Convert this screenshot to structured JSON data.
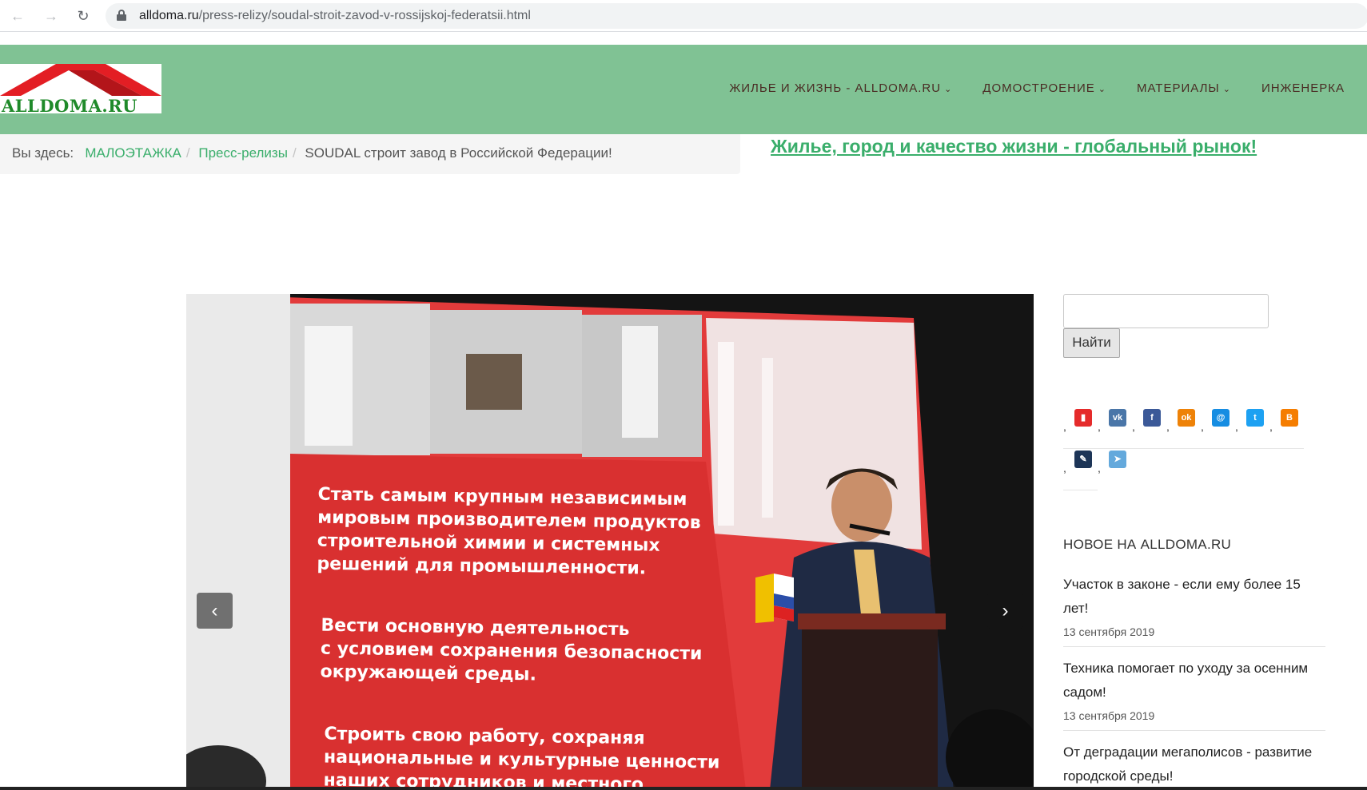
{
  "browser": {
    "url_host": "alldoma.ru",
    "url_path": "/press-relizy/soudal-stroit-zavod-v-rossijskoj-federatsii.html"
  },
  "header": {
    "logo_text": "ALLDOMA.RU",
    "bg_color": "#80c294",
    "nav": [
      {
        "label": "ЖИЛЬЕ И ЖИЗНЬ - ALLDOMA.RU",
        "has_dropdown": true
      },
      {
        "label": "ДОМОСТРОЕНИЕ",
        "has_dropdown": true
      },
      {
        "label": "МАТЕРИАЛЫ",
        "has_dropdown": true
      },
      {
        "label": "ИНЖЕНЕРКА",
        "has_dropdown": false
      }
    ]
  },
  "breadcrumb": {
    "prefix": "Вы здесь:",
    "items": [
      "МАЛОЭТАЖКА",
      "Пресс-релизы",
      "SOUDAL строит завод в Российской Федерации!"
    ]
  },
  "promo_link": "Жилье, город и качество жизни - глобальный рынок!",
  "slider": {
    "text_blocks": [
      "Стать самым крупным независимым\nмировым производителем продуктов\nстроительной химии и системных\nрешений для промышленности.",
      "Вести основную деятельность\nс условием сохранения безопасности\nокружающей среды.",
      "Строить свою работу, сохраняя\nнациональные и культурные ценности\nнаших сотрудников и местного"
    ],
    "prev_icon": "chevron-left-icon",
    "next_icon": "chevron-right-icon"
  },
  "sidebar": {
    "search_button": "Найти",
    "share_icons": [
      {
        "name": "bookmark-icon",
        "color": "#e52b2b",
        "glyph": "▮"
      },
      {
        "name": "vk-icon",
        "color": "#4a76a8",
        "glyph": "vk"
      },
      {
        "name": "facebook-icon",
        "color": "#3b5998",
        "glyph": "f"
      },
      {
        "name": "odnoklassniki-icon",
        "color": "#ee8208",
        "glyph": "ok"
      },
      {
        "name": "mailru-icon",
        "color": "#168de2",
        "glyph": "@"
      },
      {
        "name": "twitter-icon",
        "color": "#1da1f2",
        "glyph": "t"
      },
      {
        "name": "blogger-icon",
        "color": "#f57d00",
        "glyph": "B"
      },
      {
        "name": "livejournal-icon",
        "color": "#1d3557",
        "glyph": "✎"
      },
      {
        "name": "telegram-icon",
        "color": "#64a9dc",
        "glyph": "➤"
      }
    ],
    "news_title": "НОВОЕ НА ALLDOMA.RU",
    "news": [
      {
        "title": "Участок в законе - если ему более 15 лет!",
        "date": "13 сентября 2019"
      },
      {
        "title": "Техника помогает по уходу за осенним садом!",
        "date": "13 сентября 2019"
      },
      {
        "title": "От деградации мегаполисов - развитие городской среды!",
        "date": ""
      }
    ]
  }
}
